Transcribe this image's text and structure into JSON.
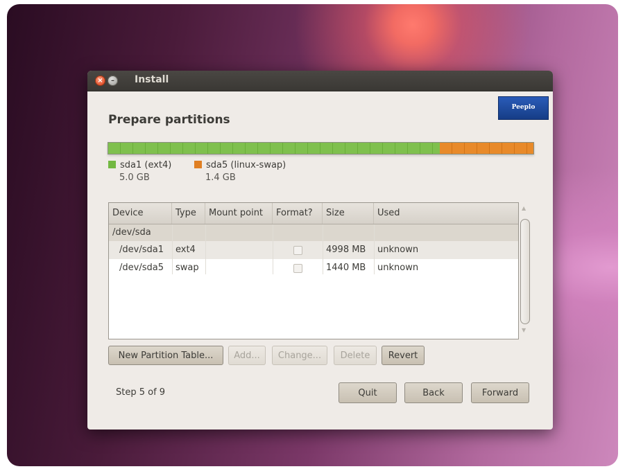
{
  "window": {
    "title": "Install"
  },
  "page": {
    "heading": "Prepare partitions",
    "logo_text": "Peeplo"
  },
  "partition_bar": {
    "segments": [
      {
        "name": "sda1 (ext4)",
        "size": "5.0 GB",
        "color": "#73b842",
        "fraction": 0.78
      },
      {
        "name": "sda5 (linux-swap)",
        "size": "1.4 GB",
        "color": "#e07f22",
        "fraction": 0.22
      }
    ]
  },
  "table": {
    "headers": [
      "Device",
      "Type",
      "Mount point",
      "Format?",
      "Size",
      "Used"
    ],
    "group": "/dev/sda",
    "rows": [
      {
        "device": "/dev/sda1",
        "type": "ext4",
        "mount": "",
        "format": false,
        "size": "4998 MB",
        "used": "unknown"
      },
      {
        "device": "/dev/sda5",
        "type": "swap",
        "mount": "",
        "format": false,
        "size": "1440 MB",
        "used": "unknown"
      }
    ]
  },
  "buttons": {
    "new_partition_table": "New Partition Table...",
    "add": "Add...",
    "change": "Change...",
    "delete": "Delete",
    "revert": "Revert",
    "quit": "Quit",
    "back": "Back",
    "forward": "Forward"
  },
  "footer": {
    "step": "Step 5 of 9"
  }
}
